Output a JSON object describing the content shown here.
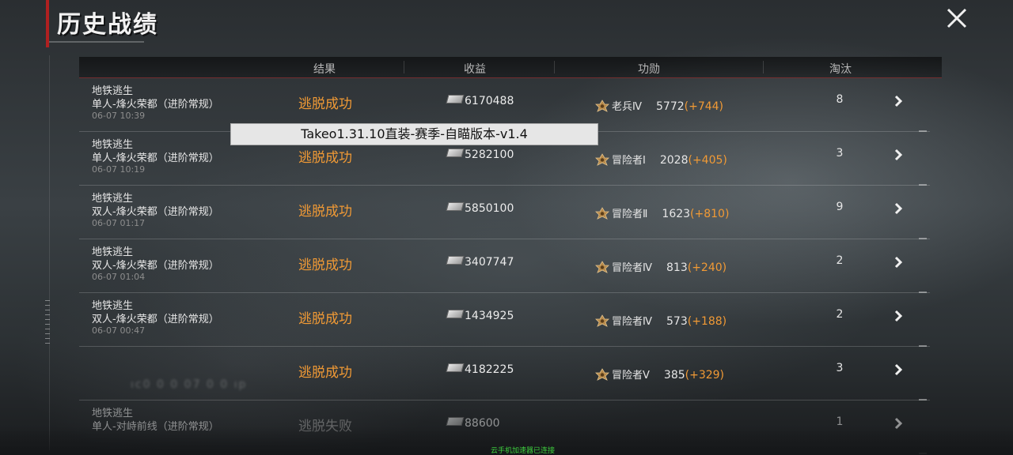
{
  "page": {
    "title": "历史战绩"
  },
  "header": {
    "columns": [
      "结果",
      "收益",
      "功勋",
      "淘汰"
    ]
  },
  "rows": [
    {
      "mode": "地铁逃生",
      "map": "单人-烽火荣都（进阶常规）",
      "time": "06-07 10:39",
      "result": "逃脱成功",
      "earnings": "6170488",
      "rank": "老兵Ⅳ",
      "points": "5772",
      "delta": "(+744)",
      "kills": "8"
    },
    {
      "mode": "地铁逃生",
      "map": "单人-烽火荣都（进阶常规）",
      "time": "06-07 10:19",
      "result": "逃脱成功",
      "earnings": "5282100",
      "rank": "冒险者Ⅰ",
      "points": "2028",
      "delta": "(+405)",
      "kills": "3"
    },
    {
      "mode": "地铁逃生",
      "map": "双人-烽火荣都（进阶常规）",
      "time": "06-07 01:17",
      "result": "逃脱成功",
      "earnings": "5850100",
      "rank": "冒险者Ⅱ",
      "points": "1623",
      "delta": "(+810)",
      "kills": "9"
    },
    {
      "mode": "地铁逃生",
      "map": "双人-烽火荣都（进阶常规）",
      "time": "06-07 01:04",
      "result": "逃脱成功",
      "earnings": "3407747",
      "rank": "冒险者Ⅳ",
      "points": "813",
      "delta": "(+240)",
      "kills": "2"
    },
    {
      "mode": "地铁逃生",
      "map": "双人-烽火荣都（进阶常规）",
      "time": "06-07 00:47",
      "result": "逃脱成功",
      "earnings": "1434925",
      "rank": "冒险者Ⅳ",
      "points": "573",
      "delta": "(+188)",
      "kills": "2"
    },
    {
      "mode": "",
      "map": "",
      "time": "",
      "result": "逃脱成功",
      "earnings": "4182225",
      "rank": "冒险者Ⅴ",
      "points": "385",
      "delta": "(+329)",
      "kills": "3"
    },
    {
      "mode": "地铁逃生",
      "map": "单人-对峙前线（进阶常规）",
      "time": "",
      "result": "逃脱失败",
      "earnings": "88600",
      "rank": "",
      "points": "",
      "delta": "",
      "kills": "1"
    }
  ],
  "overlay": {
    "watermark": "Takeo1.31.10直装-赛季-自瞄版本-v1.4"
  },
  "footer": {
    "status": "云手机加速器已连接"
  },
  "colors": {
    "accent": "#f19a35",
    "frame_red": "#b02020",
    "status_green": "#3ecf3e"
  },
  "icons": {
    "close": "close-icon",
    "earnings": "cash-icon",
    "rank": "medal-icon",
    "row": "chevron-right-icon"
  }
}
